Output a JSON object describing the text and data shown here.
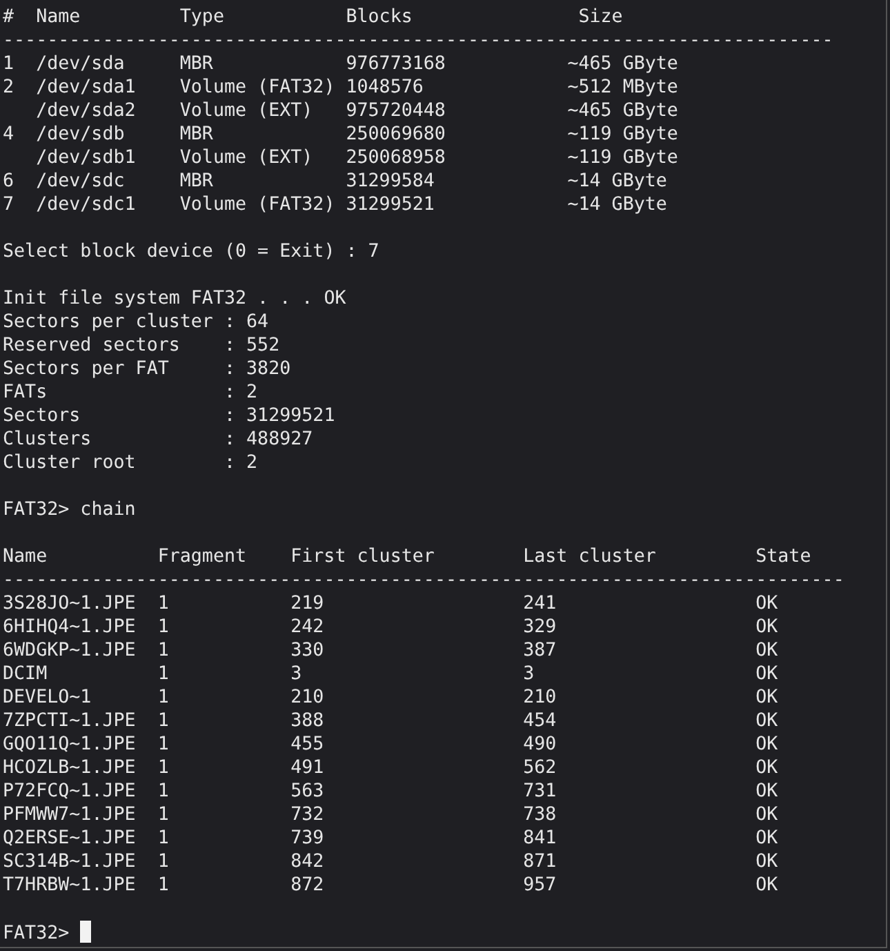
{
  "devices": {
    "columns": [
      "#",
      "Name",
      "Type",
      "Blocks",
      "Size"
    ],
    "separator": "---------------------------------------------------------------------------",
    "rows": [
      {
        "index": "1",
        "name": "/dev/sda",
        "type": "MBR",
        "blocks": "976773168",
        "size": "~465 GByte"
      },
      {
        "index": "2",
        "name": "/dev/sda1",
        "type": "Volume (FAT32)",
        "blocks": "1048576",
        "size": "~512 MByte"
      },
      {
        "name": "/dev/sda2",
        "type": "Volume (EXT)",
        "blocks": "975720448",
        "size": "~465 GByte"
      },
      {
        "index": "4",
        "name": "/dev/sdb",
        "type": "MBR",
        "blocks": "250069680",
        "size": "~119 GByte"
      },
      {
        "name": "/dev/sdb1",
        "type": "Volume (EXT)",
        "blocks": "250068958",
        "size": "~119 GByte"
      },
      {
        "index": "6",
        "name": "/dev/sdc",
        "type": "MBR",
        "blocks": "31299584",
        "size": "~14 GByte"
      },
      {
        "index": "7",
        "name": "/dev/sdc1",
        "type": "Volume (FAT32)",
        "blocks": "31299521",
        "size": "~14 GByte"
      }
    ]
  },
  "select_prompt": {
    "text": "Select block device (0 = Exit) :",
    "input": "7"
  },
  "init_line": "Init file system FAT32 . . . OK",
  "fs_info": [
    "Sectors per cluster : 64",
    "Reserved sectors    : 552",
    "Sectors per FAT     : 3820",
    "FATs                : 2",
    "Sectors             : 31299521",
    "Clusters            : 488927",
    "Cluster root        : 2"
  ],
  "command": {
    "prompt": "FAT32>",
    "input": "chain"
  },
  "chain": {
    "columns": [
      "Name",
      "Fragment",
      "First cluster",
      "Last cluster",
      "State"
    ],
    "separator": "----------------------------------------------------------------------------",
    "rows": [
      [
        "3S28JO~1.JPE",
        "1",
        "219",
        "241",
        "OK"
      ],
      [
        "6HIHQ4~1.JPE",
        "1",
        "242",
        "329",
        "OK"
      ],
      [
        "6WDGKP~1.JPE",
        "1",
        "330",
        "387",
        "OK"
      ],
      [
        "DCIM",
        "1",
        "3",
        "3",
        "OK"
      ],
      [
        "DEVELO~1",
        "1",
        "210",
        "210",
        "OK"
      ],
      [
        "7ZPCTI~1.JPE",
        "1",
        "388",
        "454",
        "OK"
      ],
      [
        "GQO11Q~1.JPE",
        "1",
        "455",
        "490",
        "OK"
      ],
      [
        "HCOZLB~1.JPE",
        "1",
        "491",
        "562",
        "OK"
      ],
      [
        "P72FCQ~1.JPE",
        "1",
        "563",
        "731",
        "OK"
      ],
      [
        "PFMWW7~1.JPE",
        "1",
        "732",
        "738",
        "OK"
      ],
      [
        "Q2ERSE~1.JPE",
        "1",
        "739",
        "841",
        "OK"
      ],
      [
        "SC314B~1.JPE",
        "1",
        "842",
        "871",
        "OK"
      ],
      [
        "T7HRBW~1.JPE",
        "1",
        "872",
        "957",
        "OK"
      ]
    ]
  },
  "final_prompt": {
    "prompt": "FAT32>"
  }
}
